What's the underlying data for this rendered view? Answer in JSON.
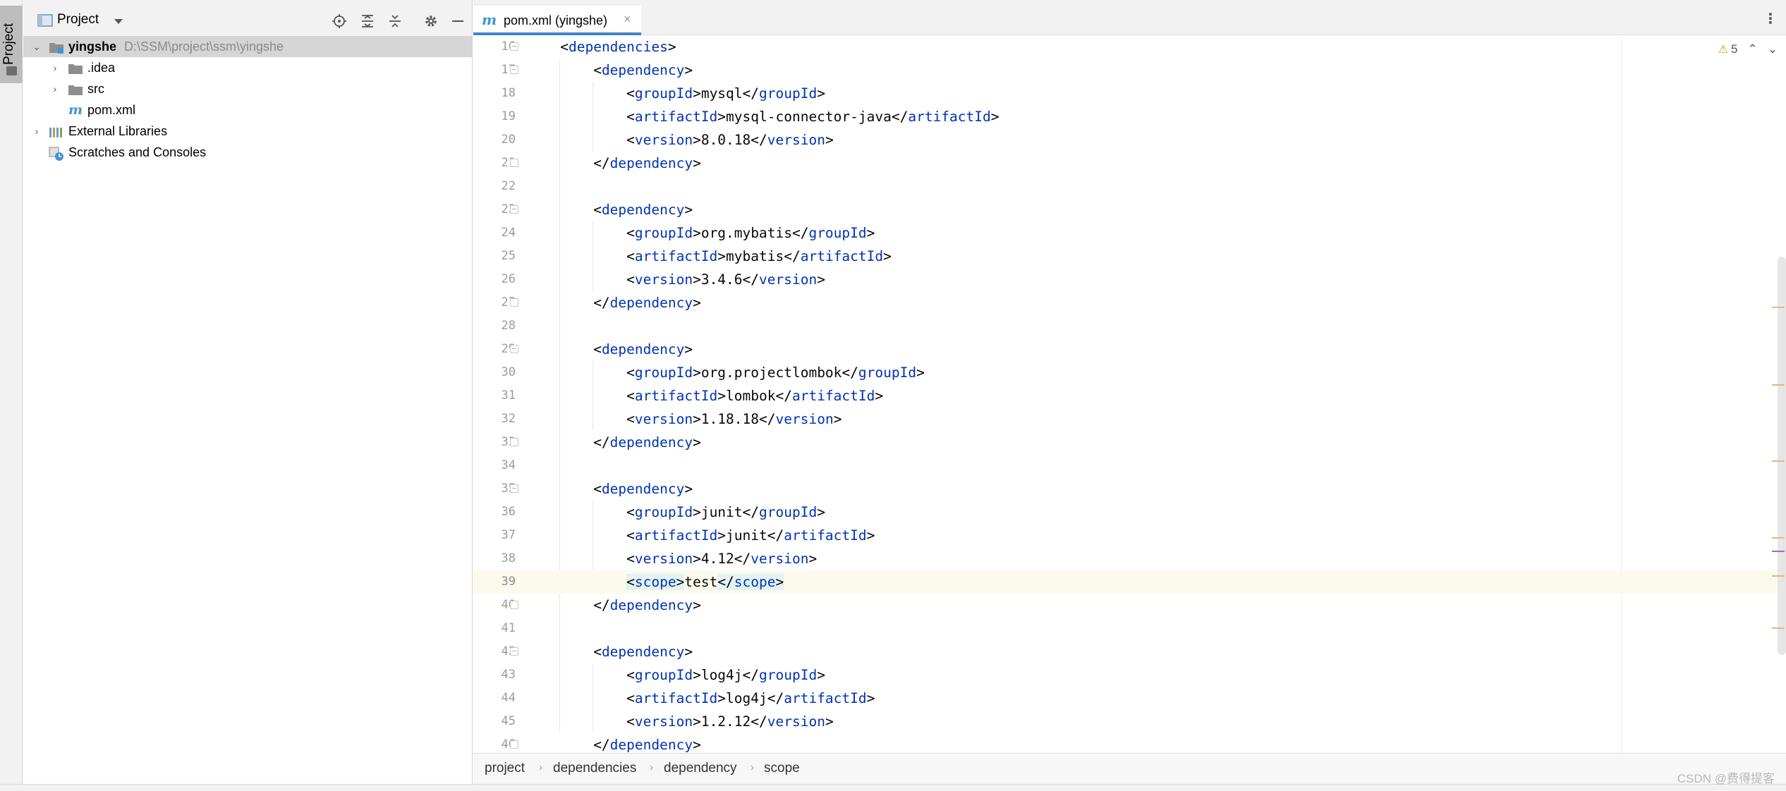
{
  "stripe": {
    "tab_label": "Project"
  },
  "panel": {
    "title": "Project",
    "tree": [
      {
        "name": "yingshe",
        "path": "D:\\SSM\\project\\ssm\\yingshe"
      },
      {
        "name": ".idea"
      },
      {
        "name": "src"
      },
      {
        "name": "pom.xml"
      },
      {
        "name": "External Libraries"
      },
      {
        "name": "Scratches and Consoles"
      }
    ]
  },
  "editor": {
    "tab": {
      "icon_letter": "m",
      "label": "pom.xml (yingshe)",
      "close": "×"
    },
    "warnings": {
      "count": "5"
    },
    "lines": [
      {
        "n": "16",
        "indent": 1,
        "parts": [
          [
            "p",
            "<"
          ],
          [
            "t",
            "dependencies"
          ],
          [
            "p",
            ">"
          ]
        ]
      },
      {
        "n": "17",
        "indent": 2,
        "parts": [
          [
            "p",
            "<"
          ],
          [
            "t",
            "dependency"
          ],
          [
            "p",
            ">"
          ]
        ]
      },
      {
        "n": "18",
        "indent": 3,
        "parts": [
          [
            "p",
            "<"
          ],
          [
            "t",
            "groupId"
          ],
          [
            "p",
            ">"
          ],
          [
            "x",
            "mysql"
          ],
          [
            "p",
            "</"
          ],
          [
            "t",
            "groupId"
          ],
          [
            "p",
            ">"
          ]
        ]
      },
      {
        "n": "19",
        "indent": 3,
        "parts": [
          [
            "p",
            "<"
          ],
          [
            "t",
            "artifactId"
          ],
          [
            "p",
            ">"
          ],
          [
            "x",
            "mysql-connector-java"
          ],
          [
            "p",
            "</"
          ],
          [
            "t",
            "artifactId"
          ],
          [
            "p",
            ">"
          ]
        ]
      },
      {
        "n": "20",
        "indent": 3,
        "parts": [
          [
            "p",
            "<"
          ],
          [
            "t",
            "version"
          ],
          [
            "p",
            ">"
          ],
          [
            "x",
            "8.0.18"
          ],
          [
            "p",
            "</"
          ],
          [
            "t",
            "version"
          ],
          [
            "p",
            ">"
          ]
        ]
      },
      {
        "n": "21",
        "indent": 2,
        "parts": [
          [
            "p",
            "</"
          ],
          [
            "t",
            "dependency"
          ],
          [
            "p",
            ">"
          ]
        ]
      },
      {
        "n": "22",
        "indent": 0,
        "parts": []
      },
      {
        "n": "23",
        "indent": 2,
        "parts": [
          [
            "p",
            "<"
          ],
          [
            "t",
            "dependency"
          ],
          [
            "p",
            ">"
          ]
        ]
      },
      {
        "n": "24",
        "indent": 3,
        "parts": [
          [
            "p",
            "<"
          ],
          [
            "t",
            "groupId"
          ],
          [
            "p",
            ">"
          ],
          [
            "x",
            "org.mybatis"
          ],
          [
            "p",
            "</"
          ],
          [
            "t",
            "groupId"
          ],
          [
            "p",
            ">"
          ]
        ]
      },
      {
        "n": "25",
        "indent": 3,
        "parts": [
          [
            "p",
            "<"
          ],
          [
            "t",
            "artifactId"
          ],
          [
            "p",
            ">"
          ],
          [
            "x",
            "mybatis"
          ],
          [
            "p",
            "</"
          ],
          [
            "t",
            "artifactId"
          ],
          [
            "p",
            ">"
          ]
        ]
      },
      {
        "n": "26",
        "indent": 3,
        "parts": [
          [
            "p",
            "<"
          ],
          [
            "t",
            "version"
          ],
          [
            "p",
            ">"
          ],
          [
            "x",
            "3.4.6"
          ],
          [
            "p",
            "</"
          ],
          [
            "t",
            "version"
          ],
          [
            "p",
            ">"
          ]
        ]
      },
      {
        "n": "27",
        "indent": 2,
        "parts": [
          [
            "p",
            "</"
          ],
          [
            "t",
            "dependency"
          ],
          [
            "p",
            ">"
          ]
        ]
      },
      {
        "n": "28",
        "indent": 0,
        "parts": []
      },
      {
        "n": "29",
        "indent": 2,
        "parts": [
          [
            "p",
            "<"
          ],
          [
            "t",
            "dependency"
          ],
          [
            "p",
            ">"
          ]
        ]
      },
      {
        "n": "30",
        "indent": 3,
        "parts": [
          [
            "p",
            "<"
          ],
          [
            "t",
            "groupId"
          ],
          [
            "p",
            ">"
          ],
          [
            "x",
            "org.projectlombok"
          ],
          [
            "p",
            "</"
          ],
          [
            "t",
            "groupId"
          ],
          [
            "p",
            ">"
          ]
        ]
      },
      {
        "n": "31",
        "indent": 3,
        "parts": [
          [
            "p",
            "<"
          ],
          [
            "t",
            "artifactId"
          ],
          [
            "p",
            ">"
          ],
          [
            "x",
            "lombok"
          ],
          [
            "p",
            "</"
          ],
          [
            "t",
            "artifactId"
          ],
          [
            "p",
            ">"
          ]
        ]
      },
      {
        "n": "32",
        "indent": 3,
        "parts": [
          [
            "p",
            "<"
          ],
          [
            "t",
            "version"
          ],
          [
            "p",
            ">"
          ],
          [
            "x",
            "1.18.18"
          ],
          [
            "p",
            "</"
          ],
          [
            "t",
            "version"
          ],
          [
            "p",
            ">"
          ]
        ]
      },
      {
        "n": "33",
        "indent": 2,
        "parts": [
          [
            "p",
            "</"
          ],
          [
            "t",
            "dependency"
          ],
          [
            "p",
            ">"
          ]
        ]
      },
      {
        "n": "34",
        "indent": 0,
        "parts": []
      },
      {
        "n": "35",
        "indent": 2,
        "parts": [
          [
            "p",
            "<"
          ],
          [
            "t",
            "dependency"
          ],
          [
            "p",
            ">"
          ]
        ]
      },
      {
        "n": "36",
        "indent": 3,
        "parts": [
          [
            "p",
            "<"
          ],
          [
            "t",
            "groupId"
          ],
          [
            "p",
            ">"
          ],
          [
            "x",
            "junit"
          ],
          [
            "p",
            "</"
          ],
          [
            "t",
            "groupId"
          ],
          [
            "p",
            ">"
          ]
        ]
      },
      {
        "n": "37",
        "indent": 3,
        "parts": [
          [
            "p",
            "<"
          ],
          [
            "t",
            "artifactId"
          ],
          [
            "p",
            ">"
          ],
          [
            "x",
            "junit"
          ],
          [
            "p",
            "</"
          ],
          [
            "t",
            "artifactId"
          ],
          [
            "p",
            ">"
          ]
        ]
      },
      {
        "n": "38",
        "indent": 3,
        "parts": [
          [
            "p",
            "<"
          ],
          [
            "t",
            "version"
          ],
          [
            "p",
            ">"
          ],
          [
            "x",
            "4.12"
          ],
          [
            "p",
            "</"
          ],
          [
            "t",
            "version"
          ],
          [
            "p",
            ">"
          ]
        ]
      },
      {
        "n": "39",
        "indent": 3,
        "current": true,
        "parts": [
          [
            "hp",
            "<"
          ],
          [
            "ht",
            "scope"
          ],
          [
            "hp",
            ">"
          ],
          [
            "x",
            "test"
          ],
          [
            "hp",
            "</"
          ],
          [
            "ht",
            "scope"
          ],
          [
            "hp",
            ">"
          ]
        ]
      },
      {
        "n": "40",
        "indent": 2,
        "parts": [
          [
            "p",
            "</"
          ],
          [
            "t",
            "dependency"
          ],
          [
            "p",
            ">"
          ]
        ]
      },
      {
        "n": "41",
        "indent": 0,
        "parts": []
      },
      {
        "n": "42",
        "indent": 2,
        "parts": [
          [
            "p",
            "<"
          ],
          [
            "t",
            "dependency"
          ],
          [
            "p",
            ">"
          ]
        ]
      },
      {
        "n": "43",
        "indent": 3,
        "parts": [
          [
            "p",
            "<"
          ],
          [
            "t",
            "groupId"
          ],
          [
            "p",
            ">"
          ],
          [
            "x",
            "log4j"
          ],
          [
            "p",
            "</"
          ],
          [
            "t",
            "groupId"
          ],
          [
            "p",
            ">"
          ]
        ]
      },
      {
        "n": "44",
        "indent": 3,
        "parts": [
          [
            "p",
            "<"
          ],
          [
            "t",
            "artifactId"
          ],
          [
            "p",
            ">"
          ],
          [
            "x",
            "log4j"
          ],
          [
            "p",
            "</"
          ],
          [
            "t",
            "artifactId"
          ],
          [
            "p",
            ">"
          ]
        ]
      },
      {
        "n": "45",
        "indent": 3,
        "parts": [
          [
            "p",
            "<"
          ],
          [
            "t",
            "version"
          ],
          [
            "p",
            ">"
          ],
          [
            "x",
            "1.2.12"
          ],
          [
            "p",
            "</"
          ],
          [
            "t",
            "version"
          ],
          [
            "p",
            ">"
          ]
        ]
      },
      {
        "n": "46",
        "indent": 2,
        "parts": [
          [
            "p",
            "</"
          ],
          [
            "t",
            "dependency"
          ],
          [
            "p",
            ">"
          ]
        ]
      }
    ]
  },
  "breadcrumb": [
    "project",
    "dependencies",
    "dependency",
    "scope"
  ],
  "colors": {
    "tag": "#0033b3",
    "accent": "#4083c9",
    "current_line": "#fcfaed",
    "selection": "#d5d5d5"
  },
  "watermark": "CSDN @费得提客"
}
